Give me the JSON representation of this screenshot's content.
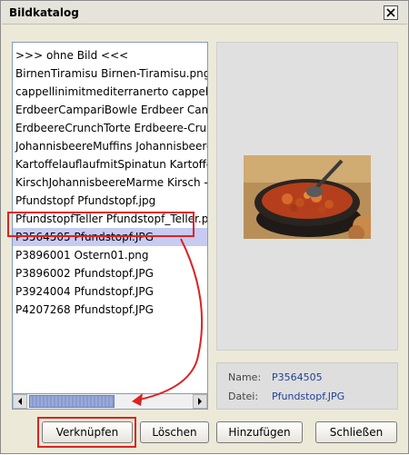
{
  "window": {
    "title": "Bildkatalog"
  },
  "list": {
    "items": [
      {
        "label": ">>> ohne Bild <<<",
        "selected": false
      },
      {
        "label": "BirnenTiramisu Birnen-Tiramisu.png",
        "selected": false
      },
      {
        "label": "cappellinimitmediterranerto cappellini mit",
        "selected": false
      },
      {
        "label": "ErdbeerCampariBowle Erdbeer Campari",
        "selected": false
      },
      {
        "label": "ErdbeereCrunchTorte Erdbeere-Crunch-Torte",
        "selected": false
      },
      {
        "label": "JohannisbeereMuffins Johannisbeere Muffins",
        "selected": false
      },
      {
        "label": "KartoffelauflaufmitSpinatun Kartoffelauflauf",
        "selected": false
      },
      {
        "label": "KirschJohannisbeereMarme Kirsch - Johannisbeere",
        "selected": false
      },
      {
        "label": "Pfundstopf Pfundstopf.jpg",
        "selected": false
      },
      {
        "label": "PfundstopfTeller Pfundstopf_Teller.png",
        "selected": false
      },
      {
        "label": "P3564505 Pfundstopf.JPG",
        "selected": true
      },
      {
        "label": "P3896001 Ostern01.png",
        "selected": false
      },
      {
        "label": "P3896002 Pfundstopf.JPG",
        "selected": false
      },
      {
        "label": "P3924004 Pfundstopf.JPG",
        "selected": false
      },
      {
        "label": "P4207268 Pfundstopf.JPG",
        "selected": false
      }
    ]
  },
  "info": {
    "name_label": "Name:",
    "name_value": "P3564505",
    "file_label": "Datei:",
    "file_value": "Pfundstopf.JPG"
  },
  "buttons": {
    "link": "Verknüpfen",
    "delete": "Löschen",
    "add": "Hinzufügen",
    "close": "Schließen"
  },
  "colors": {
    "selection": "#C7CBF1",
    "annotation": "#DD2222",
    "window_bg": "#ECE9D8"
  }
}
